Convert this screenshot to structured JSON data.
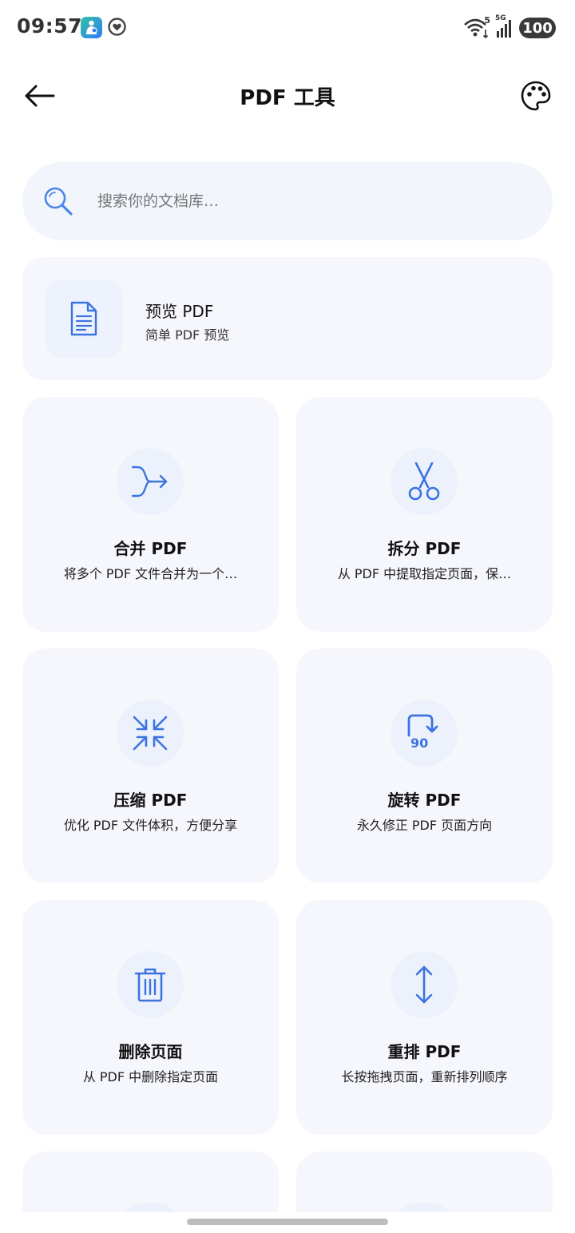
{
  "status_bar": {
    "time": "09:57",
    "network_label": "5G",
    "wifi_sub": "5",
    "battery": "100"
  },
  "header": {
    "title": "PDF 工具",
    "back_icon": "arrow-left-icon",
    "theme_icon": "palette-icon"
  },
  "search": {
    "placeholder": "搜索你的文档库…",
    "icon": "search-icon"
  },
  "preview": {
    "title": "预览 PDF",
    "subtitle": "简单 PDF 预览",
    "icon": "document-icon"
  },
  "tools": [
    {
      "title": "合并 PDF",
      "description": "将多个 PDF 文件合并为一个…",
      "icon": "merge-icon"
    },
    {
      "title": "拆分 PDF",
      "description": "从 PDF 中提取指定页面，保…",
      "icon": "scissors-icon"
    },
    {
      "title": "压缩 PDF",
      "description": "优化 PDF 文件体积，方便分享",
      "icon": "compress-icon"
    },
    {
      "title": "旋转 PDF",
      "description": "永久修正 PDF 页面方向",
      "icon": "rotate-icon",
      "icon_text": "90"
    },
    {
      "title": "删除页面",
      "description": "从 PDF 中删除指定页面",
      "icon": "trash-icon"
    },
    {
      "title": "重排 PDF",
      "description": "长按拖拽页面，重新排列顺序",
      "icon": "reorder-icon"
    }
  ],
  "colors": {
    "accent": "#3b74e0",
    "card_bg": "#f6f7fc",
    "icon_circle_bg": "#edf1fb"
  }
}
